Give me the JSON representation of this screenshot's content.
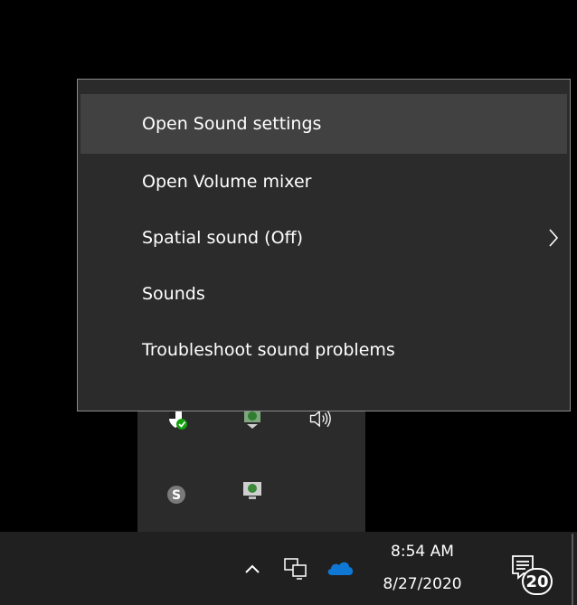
{
  "context_menu": {
    "items": [
      {
        "label": "Open Sound settings",
        "highlighted": true,
        "has_submenu": false
      },
      {
        "label": "Open Volume mixer",
        "highlighted": false,
        "has_submenu": false
      },
      {
        "label": "Spatial sound (Off)",
        "highlighted": false,
        "has_submenu": true
      },
      {
        "label": "Sounds",
        "highlighted": false,
        "has_submenu": false
      },
      {
        "label": "Troubleshoot sound problems",
        "highlighted": false,
        "has_submenu": false
      }
    ]
  },
  "tray_flyout": {
    "icons": [
      "security-shield-icon",
      "network-monitor-green-icon",
      "speaker-volume-icon",
      "skype-icon",
      "display-sync-icon"
    ]
  },
  "taskbar": {
    "icons": [
      "show-hidden-icons-chevron-icon",
      "network-icon",
      "onedrive-cloud-icon"
    ],
    "clock": {
      "time": "8:54 AM",
      "date": "8/27/2020"
    },
    "notifications": {
      "count": "20"
    }
  },
  "colors": {
    "menu_bg": "#2b2b2b",
    "menu_highlight": "#414141",
    "menu_border": "#8a8a8a",
    "taskbar_bg": "#202020",
    "onedrive_blue": "#0f78d4",
    "defender_green": "#13a10e"
  }
}
